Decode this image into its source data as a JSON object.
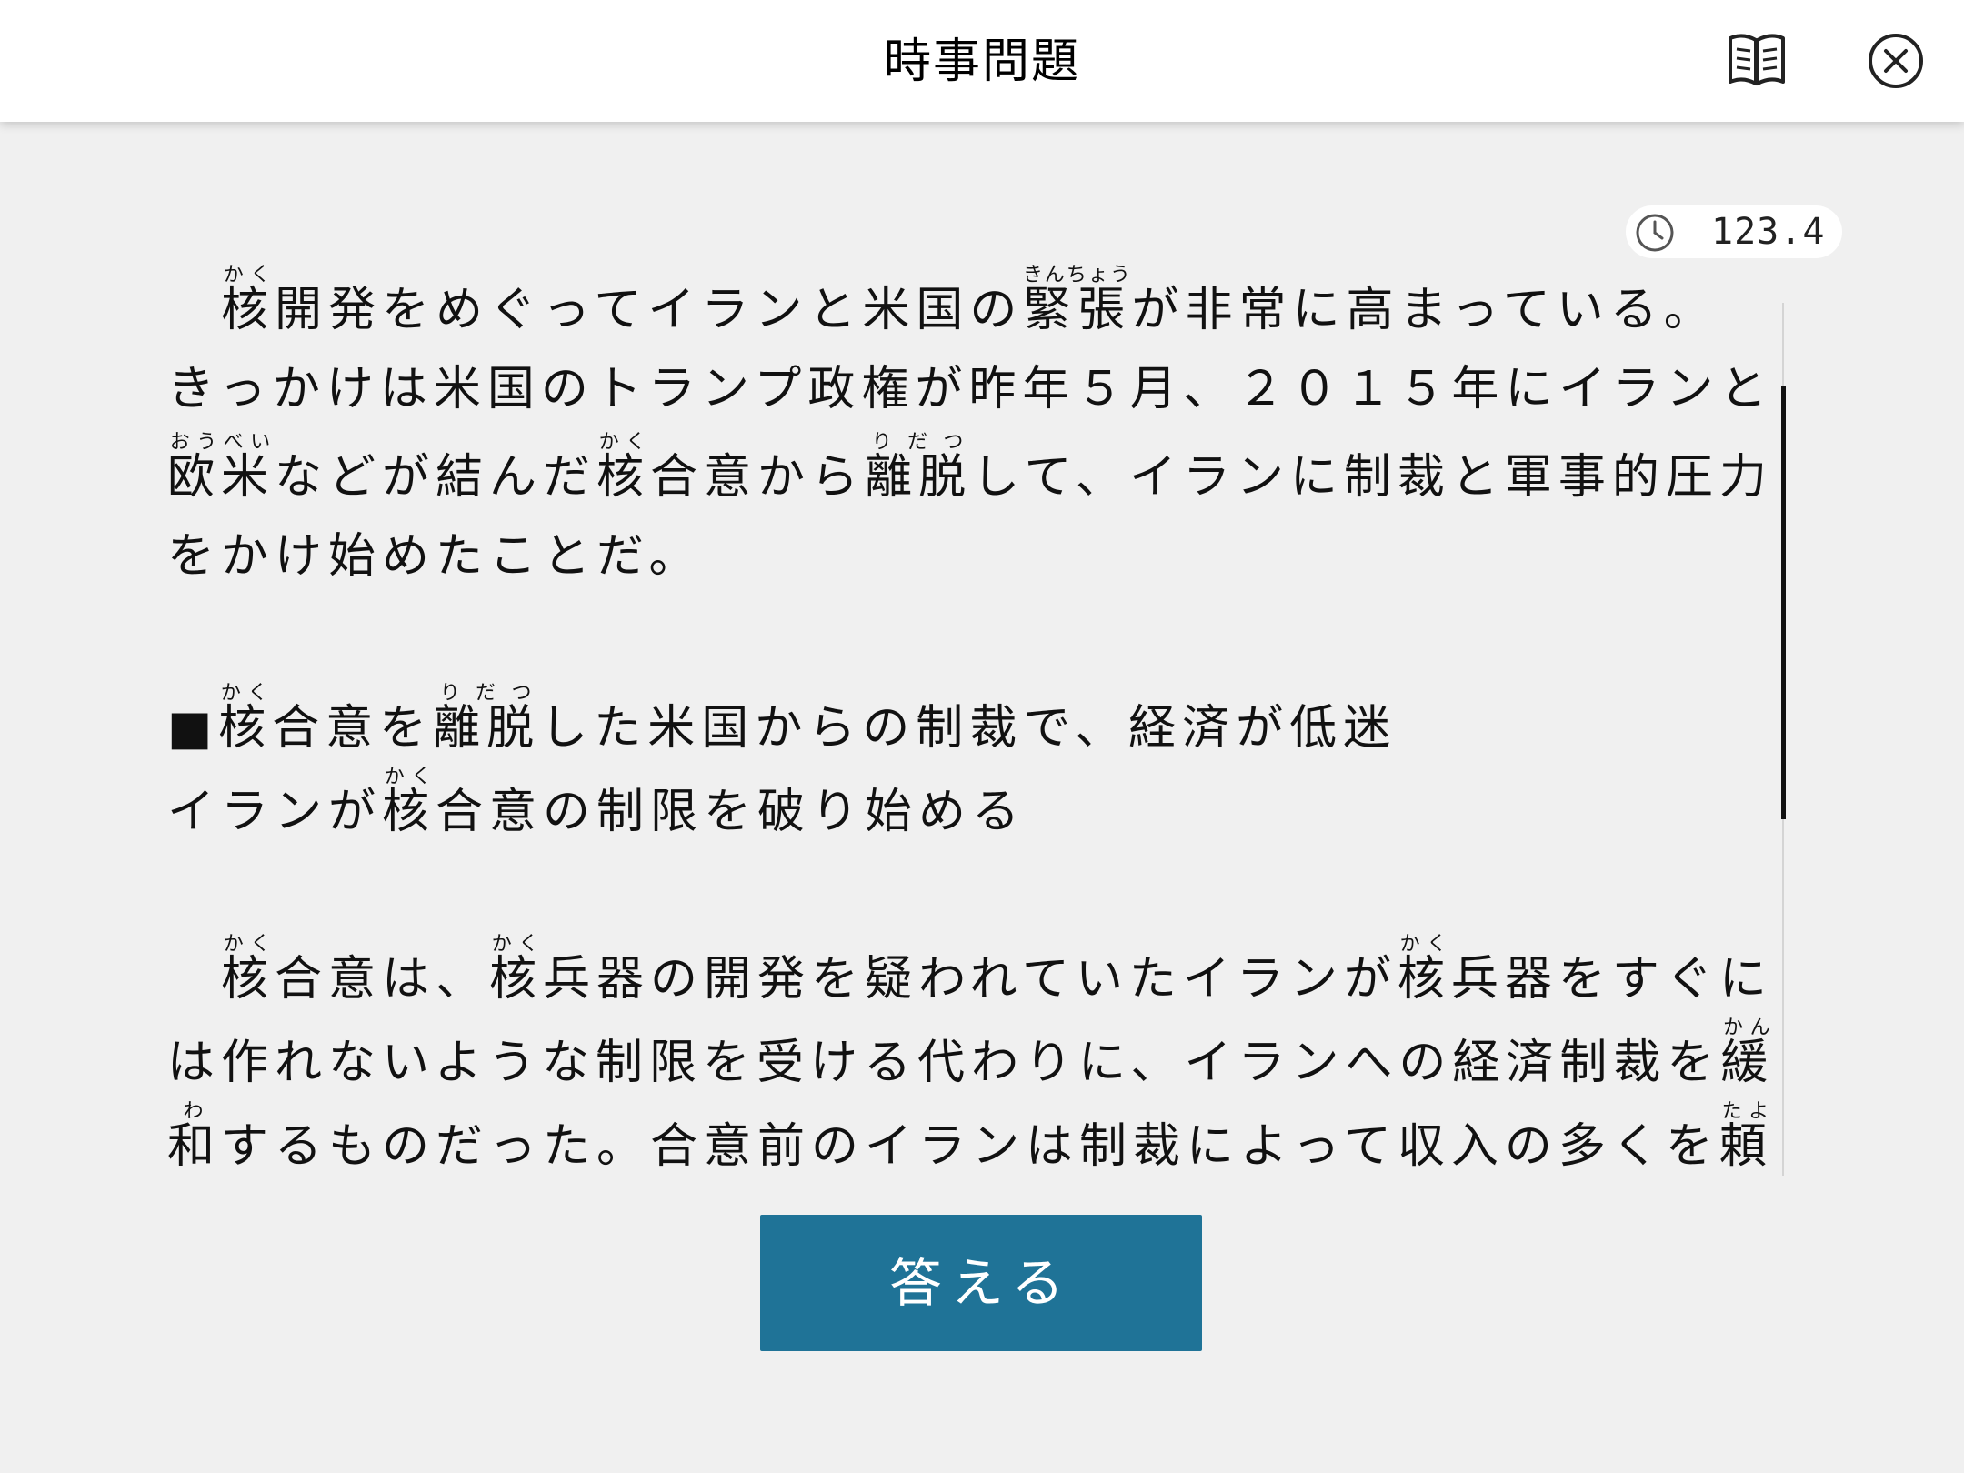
{
  "header": {
    "title": "時事問題",
    "book_icon": "open-book-icon",
    "close_icon": "close-circle-icon"
  },
  "timer": {
    "icon": "clock-icon",
    "value": "123.4"
  },
  "article": {
    "p1_l1": {
      "indent": "　",
      "r1_base": "核",
      "r1_rt": "かく",
      "t1": "開発をめぐってイランと米国の",
      "r2_base": "緊張",
      "r2_rt": "きんちょう",
      "t2": "が非常に高まっている。"
    },
    "p1_l2": "きっかけは米国のトランプ政権が昨年５月、２０１５年にイランと",
    "p1_l3": {
      "r1_base": "欧米",
      "r1_rt": "おうべい",
      "t1": "などが結んだ",
      "r2_base": "核",
      "r2_rt": "かく",
      "t2": "合意から",
      "r3_base": "離脱",
      "r3_rt": "りだつ",
      "t3": "して、イランに制裁と軍事的圧力"
    },
    "p1_l4": "をかけ始めたことだ。",
    "h1_l1": {
      "t0": "■",
      "r1_base": "核",
      "r1_rt": "かく",
      "t1": "合意を",
      "r2_base": "離脱",
      "r2_rt": "りだつ",
      "t2": "した米国からの制裁で、経済が低迷"
    },
    "h1_l2": {
      "t0": "イランが",
      "r1_base": "核",
      "r1_rt": "かく",
      "t1": "合意の制限を破り始める"
    },
    "p2_l1": {
      "indent": "　",
      "r1_base": "核",
      "r1_rt": "かく",
      "t1": "合意は、",
      "r2_base": "核",
      "r2_rt": "かく",
      "t2": "兵器の開発を疑われていたイランが",
      "r3_base": "核",
      "r3_rt": "かく",
      "t3": "兵器をすぐに"
    },
    "p2_l2": {
      "t1": "は作れないような制限を受ける代わりに、イランへの経済制裁を",
      "r1_base": "緩",
      "r1_rt": "かん"
    },
    "p2_l3": {
      "r1_base": "和",
      "r1_rt": "わ",
      "t1": "するものだった。合意前のイランは制裁によって収入の多くを",
      "r2_base": "頼",
      "r2_rt": "たよ"
    }
  },
  "answer_button": {
    "label": "答える"
  },
  "colors": {
    "accent": "#1f7397",
    "background": "#f0f0f0",
    "header": "#ffffff"
  }
}
